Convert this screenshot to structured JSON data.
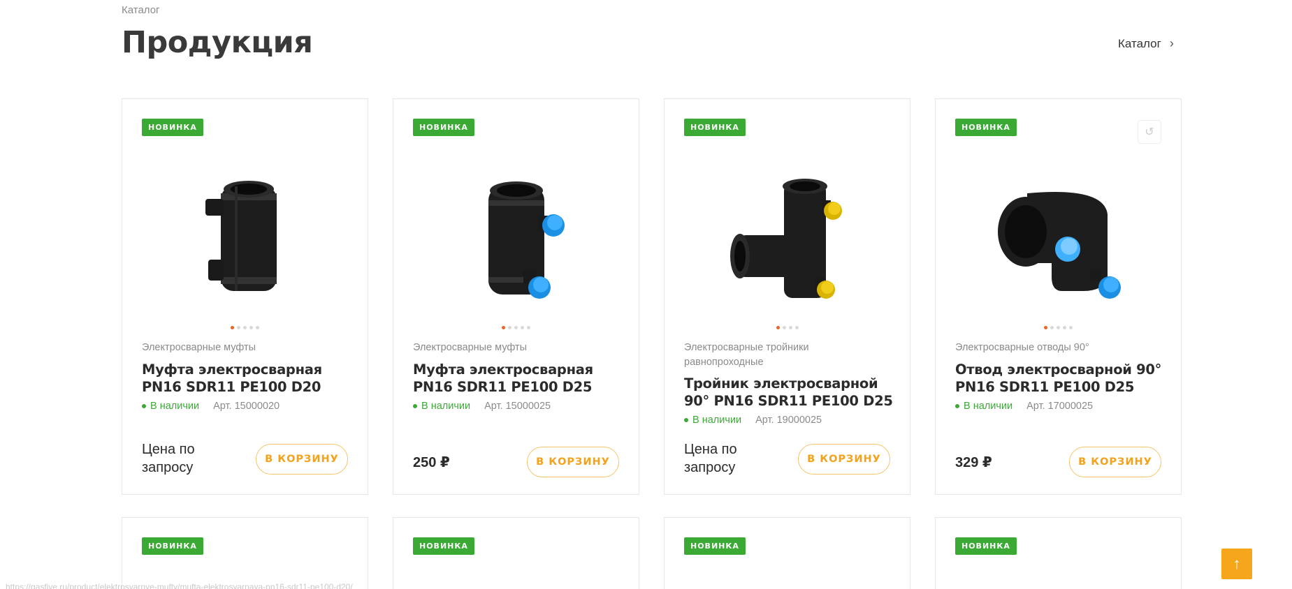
{
  "breadcrumb": "Каталог",
  "page_title": "Продукция",
  "catalog_link": "Каталог",
  "cart_label": "В КОРЗИНУ",
  "badge_label": "НОВИНКА",
  "products": [
    {
      "category": "Электросварные муфты",
      "name": "Муфта электросварная PN16 SDR11 PE100 D20",
      "stock": "В наличии",
      "art": "Арт. 15000020",
      "price": "Цена по запросу",
      "dots": 5
    },
    {
      "category": "Электросварные муфты",
      "name": "Муфта электросварная PN16 SDR11 PE100 D25",
      "stock": "В наличии",
      "art": "Арт. 15000025",
      "price": "250 ₽",
      "dots": 5
    },
    {
      "category": "Электросварные тройники равнопроходные",
      "name": "Тройник электросварной 90° PN16 SDR11 PE100 D25",
      "stock": "В наличии",
      "art": "Арт. 19000025",
      "price": "Цена по запросу",
      "dots": 4
    },
    {
      "category": "Электросварные отводы 90°",
      "name": "Отвод электросварной 90° PN16 SDR11 PE100 D25",
      "stock": "В наличии",
      "art": "Арт. 17000025",
      "price": "329 ₽",
      "dots": 5
    }
  ],
  "status_url": "https://gasfive.ru/product/elektrosvarnye-mufty/mufta-elektrosvarnaya-pn16-sdr11-pe100-d20/",
  "colors": {
    "badge": "#3aaa35",
    "accent": "#f2a21b",
    "stock": "#3aaa35",
    "scroll_top": "#f6a61a"
  }
}
